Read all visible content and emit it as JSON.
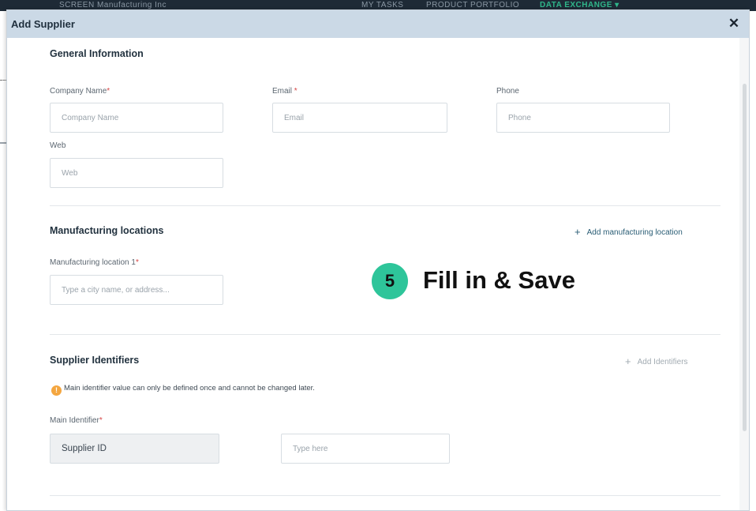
{
  "background": {
    "left_text": "SCREEN   Manufacturing Inc",
    "mid_text": "MY TASKS",
    "right_text": "PRODUCT PORTFOLIO",
    "green_text": "DATA EXCHANGE ▾"
  },
  "modal": {
    "title": "Add Supplier",
    "close_glyph": "✕"
  },
  "general": {
    "title": "General Information",
    "company_name": {
      "label": "Company Name",
      "required": "*",
      "placeholder": "Company Name"
    },
    "email": {
      "label": "Email ",
      "required": "*",
      "placeholder": "Email"
    },
    "phone": {
      "label": "Phone",
      "placeholder": "Phone"
    },
    "web": {
      "label": "Web",
      "placeholder": "Web"
    }
  },
  "manufacturing": {
    "title": "Manufacturing locations",
    "add_label": "Add manufacturing location",
    "location1": {
      "label": "Manufacturing location 1",
      "required": "*",
      "placeholder": "Type a city name, or address..."
    }
  },
  "identifiers": {
    "title": "Supplier Identifiers",
    "add_label": "Add Identifiers",
    "note": "Main identifier value can only be defined once and cannot be changed later.",
    "main_label": "Main Identifier",
    "required": "*",
    "main_value": "Supplier ID",
    "value_placeholder": "Type here"
  },
  "callout": {
    "step": "5",
    "text": "Fill in & Save"
  },
  "colors": {
    "header_bg": "#cbd9e6",
    "accent_green": "#2ec59a",
    "link": "#2a5d75",
    "required": "#d64545",
    "warning": "#f4a640"
  }
}
